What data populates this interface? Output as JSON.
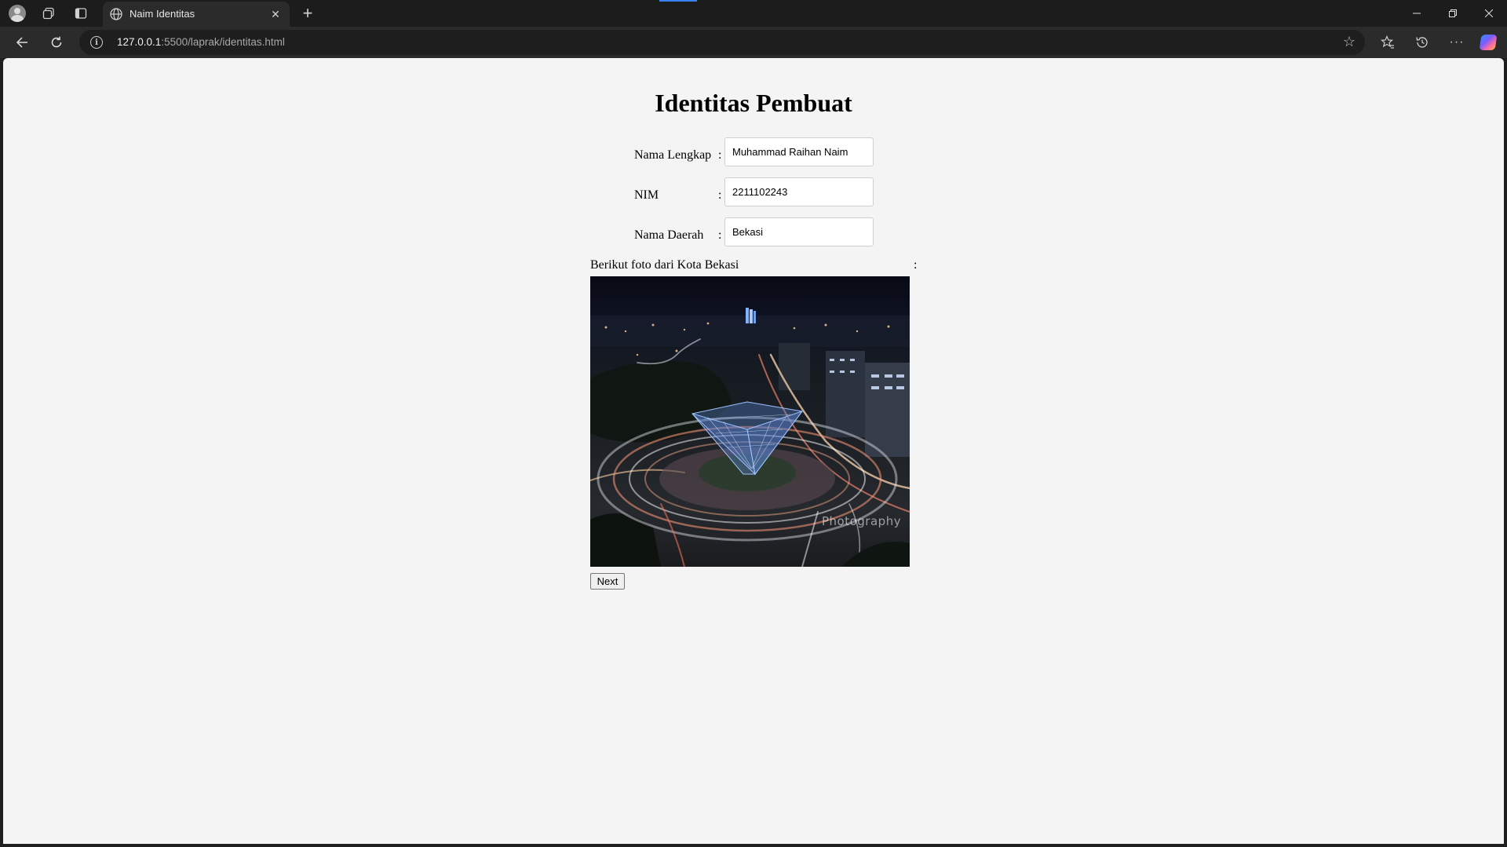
{
  "browser": {
    "tab_title": "Naim Identitas",
    "url_host": "127.0.0.1",
    "url_path": ":5500/laprak/identitas.html"
  },
  "page": {
    "heading": "Identitas Pembuat",
    "fields": [
      {
        "label": "Nama Lengkap",
        "value": "Muhammad Raihan Naim"
      },
      {
        "label": "NIM",
        "value": "2211102243"
      },
      {
        "label": "Nama Daerah",
        "value": "Bekasi"
      }
    ],
    "colon": ":",
    "photo_caption": "Berikut foto dari Kota Bekasi",
    "photo_watermark": "Photography",
    "next_button": "Next"
  },
  "icons": {
    "profile": "profile-icon",
    "workspaces": "workspaces-icon",
    "tab_actions": "tab-actions-icon",
    "globe": "globe-icon",
    "close": "close-icon",
    "new_tab": "plus-icon",
    "back": "back-arrow-icon",
    "refresh": "refresh-icon",
    "info": "info-icon",
    "favorite": "star-icon",
    "favorites": "favorites-icon",
    "history": "history-icon",
    "more": "more-icon",
    "copilot": "copilot-icon"
  },
  "colors": {
    "chrome_dark": "#1c1c1c",
    "toolbar": "#2b2b2b",
    "page_bg": "#f4f4f4",
    "accent": "#3b82f6"
  }
}
